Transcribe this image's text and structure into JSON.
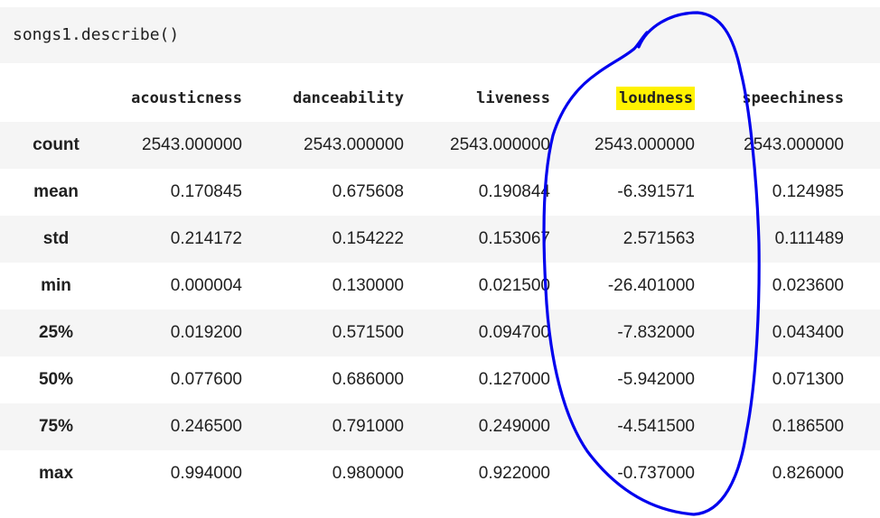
{
  "code": {
    "text": "songs1.describe()"
  },
  "table": {
    "columns": [
      "acousticness",
      "danceability",
      "liveness",
      "loudness",
      "speechiness"
    ],
    "highlighted_column": "loudness",
    "highlight_color": "#fff200",
    "rows": [
      {
        "label": "count",
        "values": [
          "2543.000000",
          "2543.000000",
          "2543.000000",
          "2543.000000",
          "2543.000000"
        ]
      },
      {
        "label": "mean",
        "values": [
          "0.170845",
          "0.675608",
          "0.190844",
          "-6.391571",
          "0.124985"
        ]
      },
      {
        "label": "std",
        "values": [
          "0.214172",
          "0.154222",
          "0.153067",
          "2.571563",
          "0.111489"
        ]
      },
      {
        "label": "min",
        "values": [
          "0.000004",
          "0.130000",
          "0.021500",
          "-26.401000",
          "0.023600"
        ]
      },
      {
        "label": "25%",
        "values": [
          "0.019200",
          "0.571500",
          "0.094700",
          "-7.832000",
          "0.043400"
        ]
      },
      {
        "label": "50%",
        "values": [
          "0.077600",
          "0.686000",
          "0.127000",
          "-5.942000",
          "0.071300"
        ]
      },
      {
        "label": "75%",
        "values": [
          "0.246500",
          "0.791000",
          "0.249000",
          "-4.541500",
          "0.186500"
        ]
      },
      {
        "label": "max",
        "values": [
          "0.994000",
          "0.980000",
          "0.922000",
          "-0.737000",
          "0.826000"
        ]
      }
    ]
  },
  "annotation": {
    "shape": "hand-drawn-loop",
    "color": "#0000ee"
  }
}
